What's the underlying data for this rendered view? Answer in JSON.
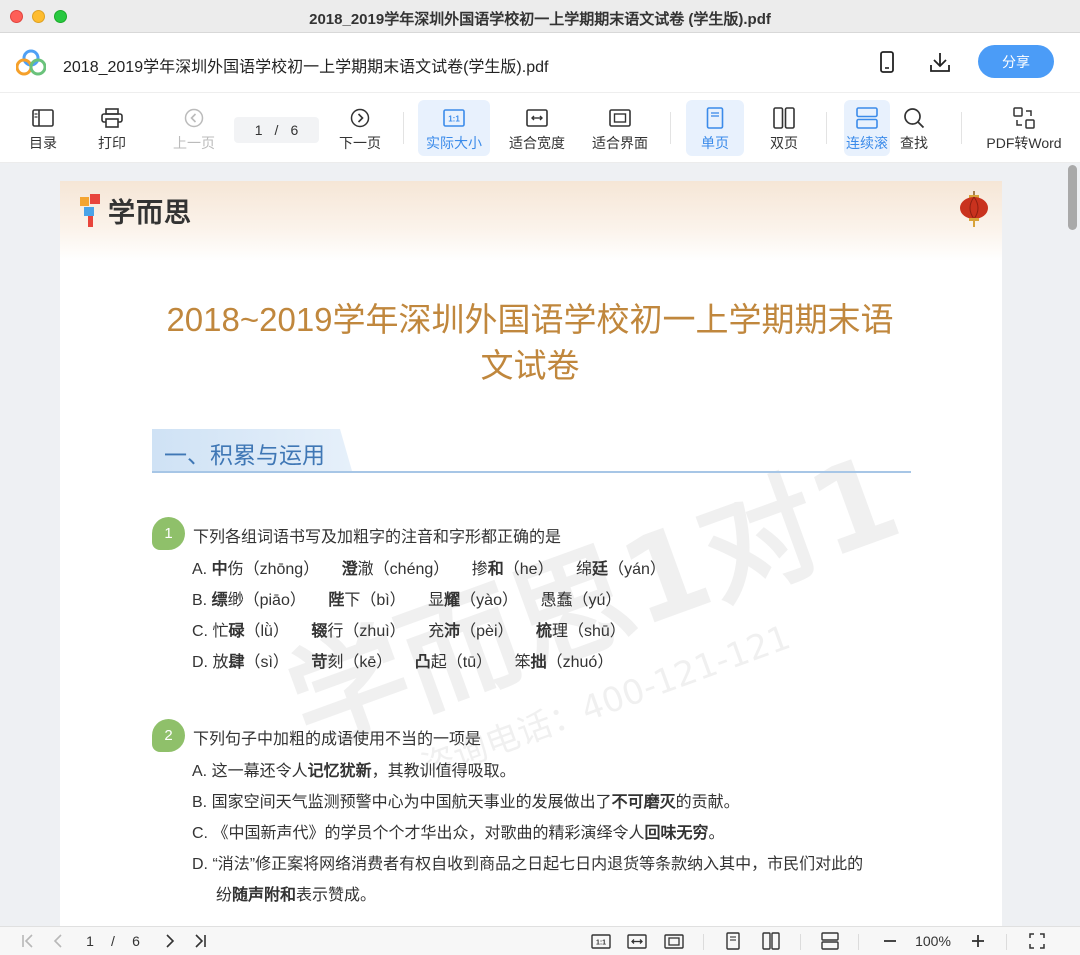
{
  "window": {
    "title": "2018_2019学年深圳外国语学校初一上学期期末语文试卷 (学生版).pdf"
  },
  "header": {
    "file_name": "2018_2019学年深圳外国语学校初一上学期期末语文试卷(学生版).pdf",
    "share_label": "分享",
    "icons": [
      "phone-icon",
      "download-icon"
    ]
  },
  "toolbar": {
    "toc": "目录",
    "print": "打印",
    "prev": "上一页",
    "page_current": "1",
    "page_sep": "/",
    "page_total": "6",
    "next": "下一页",
    "actual_size": "实际大小",
    "fit_width": "适合宽度",
    "fit_page": "适合界面",
    "single": "单页",
    "double": "双页",
    "continuous": "连续滚",
    "find": "查找",
    "pdf_to_word": "PDF转Word"
  },
  "document": {
    "brand": "学而思",
    "title_line1": "2018~2019学年深圳外国语学校初一上学期期末语",
    "title_line2": "文试卷",
    "section": "一、积累与运用",
    "watermark_main": "学而思1对1",
    "watermark_phone": "咨询电话：400-121-121",
    "questions": [
      {
        "num": "1",
        "stem": "下列各组词语书写及加粗字的注音和字形都正确的是",
        "options": [
          {
            "letter": "A.",
            "items": [
              {
                "bold": "中",
                "rest": "伤（zhōng）"
              },
              {
                "bold": "澄",
                "rest": "澈（chéng）"
              },
              {
                "bold": "",
                "rest": "掺",
                "bold2": "和",
                "rest2": "（he）"
              },
              {
                "bold": "",
                "rest": "绵",
                "bold2": "廷",
                "rest2": "（yán）"
              }
            ]
          },
          {
            "letter": "B.",
            "items": [
              {
                "bold": "缥",
                "rest": "缈（piāo）"
              },
              {
                "bold": "陛",
                "rest": "下（bì）"
              },
              {
                "bold": "",
                "rest": "显",
                "bold2": "耀",
                "rest2": "（yào）"
              },
              {
                "bold": "",
                "rest": "愚蠢（yú）"
              }
            ]
          },
          {
            "letter": "C.",
            "items": [
              {
                "bold": "",
                "rest": "忙",
                "bold2": "碌",
                "rest2": "（lǜ）"
              },
              {
                "bold": "辍",
                "rest": "行（zhuì）"
              },
              {
                "bold": "",
                "rest": "充",
                "bold2": "沛",
                "rest2": "（pèi）"
              },
              {
                "bold": "梳",
                "rest": "理（shū）"
              }
            ]
          },
          {
            "letter": "D.",
            "items": [
              {
                "bold": "",
                "rest": "放",
                "bold2": "肆",
                "rest2": "（sì）"
              },
              {
                "bold": "苛",
                "rest": "刻（kē）"
              },
              {
                "bold": "凸",
                "rest": "起（tū）"
              },
              {
                "bold": "",
                "rest": "笨",
                "bold2": "拙",
                "rest2": "（zhuó）"
              }
            ]
          }
        ]
      },
      {
        "num": "2",
        "stem": "下列句子中加粗的成语使用不当的一项是",
        "options": [
          {
            "letter": "A.",
            "pre": "这一幕还令人",
            "bold": "记忆犹新",
            "post": "，其教训值得吸取。"
          },
          {
            "letter": "B.",
            "pre": "国家空间天气监测预警中心为中国航天事业的发展做出了",
            "bold": "不可磨灭",
            "post": "的贡献。"
          },
          {
            "letter": "C.",
            "pre": "《中国新声代》的学员个个才华出众，对歌曲的精彩演绎令人",
            "bold": "回味无穷",
            "post": "。"
          },
          {
            "letter": "D.",
            "pre": "“消法”修正案将网络消费者有权自收到商品之日起七日内退货等条款纳入其中，市民们对此的",
            "line2_pre": "纷",
            "bold": "随声附和",
            "post": "表示赞成。"
          }
        ]
      }
    ]
  },
  "statusbar": {
    "page_current": "1",
    "page_sep": "/",
    "page_total": "6",
    "zoom": "100%"
  }
}
